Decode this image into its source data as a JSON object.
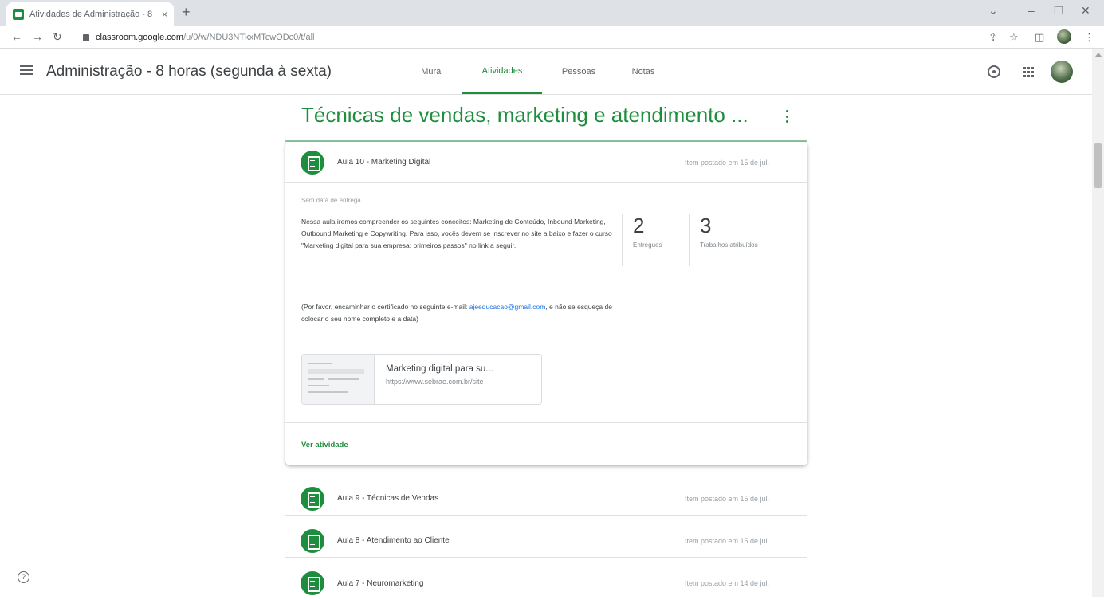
{
  "browser": {
    "tab_title": "Atividades de Administração - 8",
    "tab_close": "×",
    "new_tab": "+",
    "url_host": "classroom.google.com",
    "url_path": "/u/0/w/NDU3NTkxMTcwODc0/t/all"
  },
  "header": {
    "class_title": "Administração - 8 horas (segunda à sexta)",
    "tabs": [
      "Mural",
      "Atividades",
      "Pessoas",
      "Notas"
    ],
    "active_tab": "Atividades"
  },
  "topic": {
    "title": "Técnicas de vendas, marketing e atendimento ..."
  },
  "expanded_assignment": {
    "title": "Aula 10 - Marketing Digital",
    "posted": "Item postado em 15 de jul.",
    "due": "Sem data de entrega",
    "description": "Nessa aula iremos compreender os seguintes conceitos: Marketing de Conteúdo, Inbound Marketing, Outbound Marketing e Copywriting. Para isso, vocês devem se inscrever no site a baixo e fazer o curso \"Marketing digital para sua empresa: primeiros passos\" no link a seguir.",
    "note_prefix": "(Por favor, encaminhar o certificado no seguinte e-mail: ",
    "note_email": "ajeeducacao@gmail.com",
    "note_suffix": ", e não se esqueça de colocar o seu nome completo e a data)",
    "stats": [
      {
        "value": "2",
        "label": "Entregues"
      },
      {
        "value": "3",
        "label": "Trabalhos atribuídos"
      }
    ],
    "attachment": {
      "title": "Marketing digital para su...",
      "url": "https://www.sebrae.com.br/site"
    },
    "view_link": "Ver atividade"
  },
  "assignments": [
    {
      "title": "Aula 9 - Técnicas de Vendas",
      "posted": "Item postado em 15 de jul."
    },
    {
      "title": "Aula 8 - Atendimento ao Cliente",
      "posted": "Item postado em 15 de jul."
    },
    {
      "title": "Aula 7 - Neuromarketing",
      "posted": "Item postado em 14 de jul."
    }
  ],
  "help_label": "?",
  "colors": {
    "accent": "#1e8e3e",
    "link": "#1a73e8"
  }
}
